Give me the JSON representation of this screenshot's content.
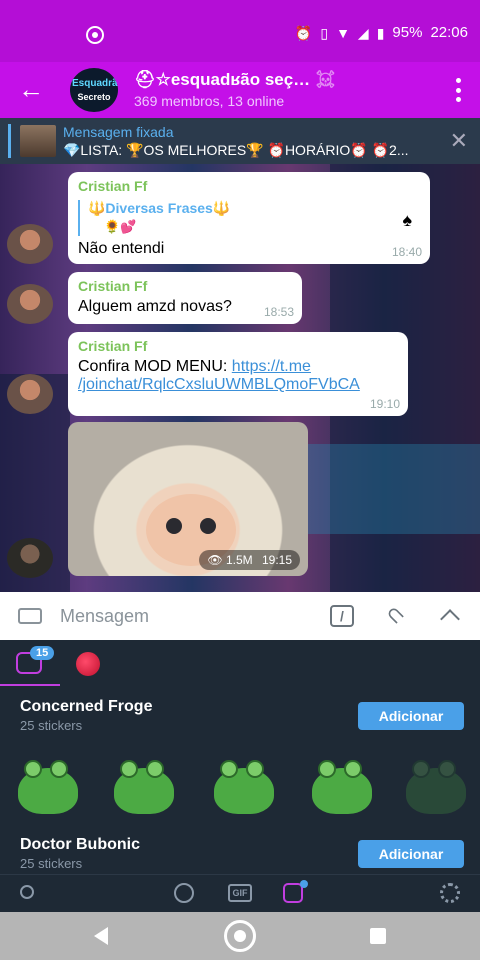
{
  "status_bar": {
    "battery": "95%",
    "time": "22:06",
    "icons": [
      "whatsapp-icon",
      "alarm-icon",
      "vibrate-icon",
      "wifi-icon",
      "signal-icon",
      "battery-icon"
    ]
  },
  "header": {
    "title": "⛑☆esquadʁão seç…",
    "title_emoji": "☠",
    "subtitle": "369 membros, 13 online",
    "avatar_line1": "Esquadrão",
    "avatar_line2": "Secreto"
  },
  "pinned": {
    "title": "Mensagem fixada",
    "text": "💎LISTA: 🏆OS MELHORES🏆 ⏰HORÁRIO⏰ ⏰2..."
  },
  "messages": [
    {
      "author": "Cristian Ff",
      "reply_title": "🔱Diversas Frases🔱",
      "reply_body": "🌻💕",
      "reply_spade": "♠",
      "text": "Não entendi",
      "time": "18:40"
    },
    {
      "author": "Cristian Ff",
      "text": "Alguem amzd novas?",
      "time": "18:53"
    },
    {
      "author": "Cristian Ff",
      "text_prefix": "Confira MOD MENU: ",
      "link_line1": "https://t.me",
      "link_line2": "/joinchat/RqlcCxsluUWMBLQmoFVbCA",
      "time": "19:10"
    },
    {
      "views": "1.5M",
      "time": "19:15"
    }
  ],
  "input": {
    "placeholder": "Mensagem"
  },
  "sticker_panel": {
    "badge": "15",
    "packs": [
      {
        "title": "Concerned Froge",
        "count": "25 stickers",
        "button": "Adicionar"
      },
      {
        "title": "Doctor Bubonic",
        "count": "25 stickers",
        "button": "Adicionar"
      }
    ],
    "toolbar_gif": "GIF"
  },
  "colors": {
    "status_bar": "#b40ed6",
    "header": "#c410e8",
    "accent": "#4aa0e8",
    "author": "#7cc35a"
  }
}
